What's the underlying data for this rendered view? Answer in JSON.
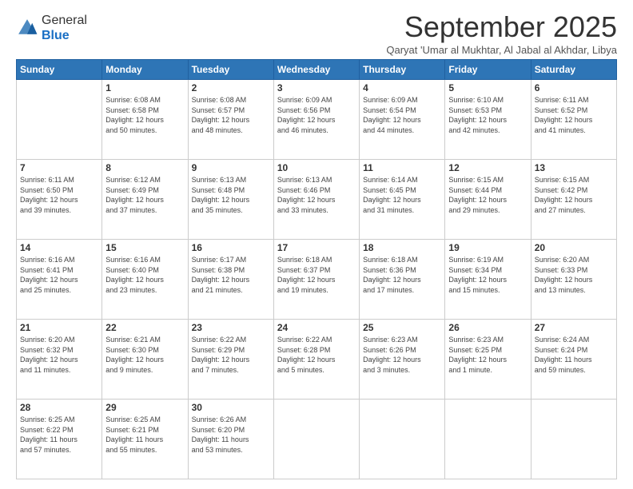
{
  "logo": {
    "general": "General",
    "blue": "Blue"
  },
  "title": "September 2025",
  "location": "Qaryat 'Umar al Mukhtar, Al Jabal al Akhdar, Libya",
  "headers": [
    "Sunday",
    "Monday",
    "Tuesday",
    "Wednesday",
    "Thursday",
    "Friday",
    "Saturday"
  ],
  "weeks": [
    [
      {
        "day": "",
        "info": ""
      },
      {
        "day": "1",
        "info": "Sunrise: 6:08 AM\nSunset: 6:58 PM\nDaylight: 12 hours\nand 50 minutes."
      },
      {
        "day": "2",
        "info": "Sunrise: 6:08 AM\nSunset: 6:57 PM\nDaylight: 12 hours\nand 48 minutes."
      },
      {
        "day": "3",
        "info": "Sunrise: 6:09 AM\nSunset: 6:56 PM\nDaylight: 12 hours\nand 46 minutes."
      },
      {
        "day": "4",
        "info": "Sunrise: 6:09 AM\nSunset: 6:54 PM\nDaylight: 12 hours\nand 44 minutes."
      },
      {
        "day": "5",
        "info": "Sunrise: 6:10 AM\nSunset: 6:53 PM\nDaylight: 12 hours\nand 42 minutes."
      },
      {
        "day": "6",
        "info": "Sunrise: 6:11 AM\nSunset: 6:52 PM\nDaylight: 12 hours\nand 41 minutes."
      }
    ],
    [
      {
        "day": "7",
        "info": "Sunrise: 6:11 AM\nSunset: 6:50 PM\nDaylight: 12 hours\nand 39 minutes."
      },
      {
        "day": "8",
        "info": "Sunrise: 6:12 AM\nSunset: 6:49 PM\nDaylight: 12 hours\nand 37 minutes."
      },
      {
        "day": "9",
        "info": "Sunrise: 6:13 AM\nSunset: 6:48 PM\nDaylight: 12 hours\nand 35 minutes."
      },
      {
        "day": "10",
        "info": "Sunrise: 6:13 AM\nSunset: 6:46 PM\nDaylight: 12 hours\nand 33 minutes."
      },
      {
        "day": "11",
        "info": "Sunrise: 6:14 AM\nSunset: 6:45 PM\nDaylight: 12 hours\nand 31 minutes."
      },
      {
        "day": "12",
        "info": "Sunrise: 6:15 AM\nSunset: 6:44 PM\nDaylight: 12 hours\nand 29 minutes."
      },
      {
        "day": "13",
        "info": "Sunrise: 6:15 AM\nSunset: 6:42 PM\nDaylight: 12 hours\nand 27 minutes."
      }
    ],
    [
      {
        "day": "14",
        "info": "Sunrise: 6:16 AM\nSunset: 6:41 PM\nDaylight: 12 hours\nand 25 minutes."
      },
      {
        "day": "15",
        "info": "Sunrise: 6:16 AM\nSunset: 6:40 PM\nDaylight: 12 hours\nand 23 minutes."
      },
      {
        "day": "16",
        "info": "Sunrise: 6:17 AM\nSunset: 6:38 PM\nDaylight: 12 hours\nand 21 minutes."
      },
      {
        "day": "17",
        "info": "Sunrise: 6:18 AM\nSunset: 6:37 PM\nDaylight: 12 hours\nand 19 minutes."
      },
      {
        "day": "18",
        "info": "Sunrise: 6:18 AM\nSunset: 6:36 PM\nDaylight: 12 hours\nand 17 minutes."
      },
      {
        "day": "19",
        "info": "Sunrise: 6:19 AM\nSunset: 6:34 PM\nDaylight: 12 hours\nand 15 minutes."
      },
      {
        "day": "20",
        "info": "Sunrise: 6:20 AM\nSunset: 6:33 PM\nDaylight: 12 hours\nand 13 minutes."
      }
    ],
    [
      {
        "day": "21",
        "info": "Sunrise: 6:20 AM\nSunset: 6:32 PM\nDaylight: 12 hours\nand 11 minutes."
      },
      {
        "day": "22",
        "info": "Sunrise: 6:21 AM\nSunset: 6:30 PM\nDaylight: 12 hours\nand 9 minutes."
      },
      {
        "day": "23",
        "info": "Sunrise: 6:22 AM\nSunset: 6:29 PM\nDaylight: 12 hours\nand 7 minutes."
      },
      {
        "day": "24",
        "info": "Sunrise: 6:22 AM\nSunset: 6:28 PM\nDaylight: 12 hours\nand 5 minutes."
      },
      {
        "day": "25",
        "info": "Sunrise: 6:23 AM\nSunset: 6:26 PM\nDaylight: 12 hours\nand 3 minutes."
      },
      {
        "day": "26",
        "info": "Sunrise: 6:23 AM\nSunset: 6:25 PM\nDaylight: 12 hours\nand 1 minute."
      },
      {
        "day": "27",
        "info": "Sunrise: 6:24 AM\nSunset: 6:24 PM\nDaylight: 11 hours\nand 59 minutes."
      }
    ],
    [
      {
        "day": "28",
        "info": "Sunrise: 6:25 AM\nSunset: 6:22 PM\nDaylight: 11 hours\nand 57 minutes."
      },
      {
        "day": "29",
        "info": "Sunrise: 6:25 AM\nSunset: 6:21 PM\nDaylight: 11 hours\nand 55 minutes."
      },
      {
        "day": "30",
        "info": "Sunrise: 6:26 AM\nSunset: 6:20 PM\nDaylight: 11 hours\nand 53 minutes."
      },
      {
        "day": "",
        "info": ""
      },
      {
        "day": "",
        "info": ""
      },
      {
        "day": "",
        "info": ""
      },
      {
        "day": "",
        "info": ""
      }
    ]
  ]
}
